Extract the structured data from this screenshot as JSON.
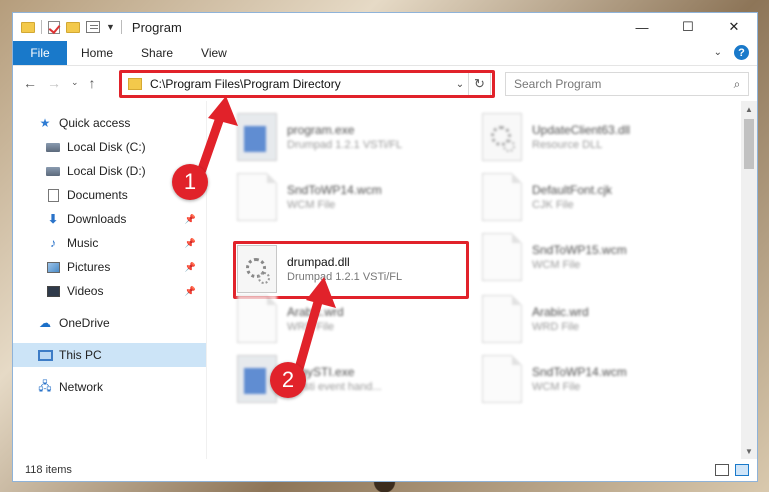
{
  "titlebar": {
    "title": "Program"
  },
  "window_controls": {
    "minimize": "—",
    "maximize": "☐",
    "close": "✕"
  },
  "ribbon": {
    "file": "File",
    "home": "Home",
    "share": "Share",
    "view": "View",
    "help": "?"
  },
  "address": {
    "path": "C:\\Program Files\\Program Directory"
  },
  "search": {
    "placeholder": "Search Program"
  },
  "sidebar": {
    "items": [
      {
        "label": "Quick access"
      },
      {
        "label": "Local Disk (C:)"
      },
      {
        "label": "Local Disk (D:)"
      },
      {
        "label": "Documents"
      },
      {
        "label": "Downloads"
      },
      {
        "label": "Music"
      },
      {
        "label": "Pictures"
      },
      {
        "label": "Videos"
      },
      {
        "label": "OneDrive"
      },
      {
        "label": "This PC"
      },
      {
        "label": "Network"
      }
    ]
  },
  "files": [
    {
      "name": "program.exe",
      "sub": "Drumpad 1.2.1 VSTi/FL"
    },
    {
      "name": "UpdateClient63.dll",
      "sub": "Resource DLL"
    },
    {
      "name": "SndToWP14.wcm",
      "sub": "WCM File"
    },
    {
      "name": "DefaultFont.cjk",
      "sub": "CJK File"
    },
    {
      "name": "drumpad.dll",
      "sub": "Drumpad 1.2.1 VSTi/FL"
    },
    {
      "name": "SndToWP15.wcm",
      "sub": "WCM File"
    },
    {
      "name": "Arabic.wrd",
      "sub": "WRD File"
    },
    {
      "name": "Arabic.wrd",
      "sub": "WRD File"
    },
    {
      "name": "abbySTI.exe",
      "sub": "ST sti event hand..."
    },
    {
      "name": "SndToWP14.wcm",
      "sub": "WCM File"
    }
  ],
  "status": {
    "items": "118 items"
  },
  "annotations": {
    "step1": "1",
    "step2": "2",
    "color": "#e1222a"
  }
}
